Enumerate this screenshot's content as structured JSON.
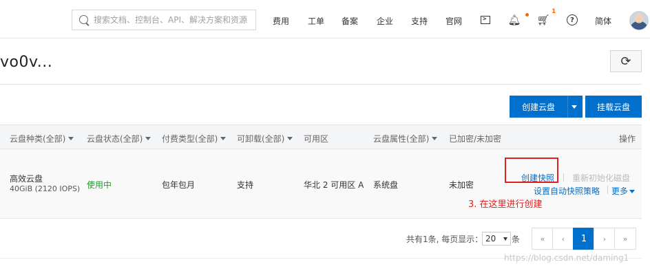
{
  "header": {
    "search_placeholder": "搜索文档、控制台、API、解决方案和资源",
    "nav": [
      "费用",
      "工单",
      "备案",
      "企业",
      "支持",
      "官网"
    ],
    "icons": [
      "terminal-icon",
      "bell-icon",
      "cart-icon",
      "help-icon"
    ],
    "cart_count": "1",
    "language": "简体"
  },
  "page": {
    "title": "vo0v..."
  },
  "toolbar": {
    "create_disk": "创建云盘",
    "attach_disk": "挂载云盘"
  },
  "table": {
    "columns": [
      "云盘种类(全部)",
      "云盘状态(全部)",
      "付费类型(全部)",
      "可卸载(全部)",
      "可用区",
      "云盘属性(全部)",
      "已加密/未加密",
      "操作"
    ],
    "rows": [
      {
        "type": "高效云盘",
        "spec": "40GiB (2120 IOPS)",
        "status": "使用中",
        "billing": "包年包月",
        "detachable": "支持",
        "zone": "华北 2 可用区 A",
        "attribute": "系统盘",
        "encryption": "未加密",
        "actions": {
          "create_snapshot": "创建快照",
          "reinit": "重新初始化磁盘",
          "auto_snapshot": "设置自动快照策略",
          "more": "更多"
        }
      }
    ]
  },
  "annotation": "3. 在这里进行创建",
  "pagination": {
    "summary": "共有1条, 每页显示：",
    "page_size": "20",
    "suffix": "条",
    "first": "«",
    "prev": "‹",
    "current": "1",
    "next": "›",
    "last": "»"
  },
  "watermark": "https://blog.csdn.net/daming1",
  "colors": {
    "primary": "#0070cc",
    "status_ok": "#1e9c2c",
    "annotation": "#e02020"
  }
}
